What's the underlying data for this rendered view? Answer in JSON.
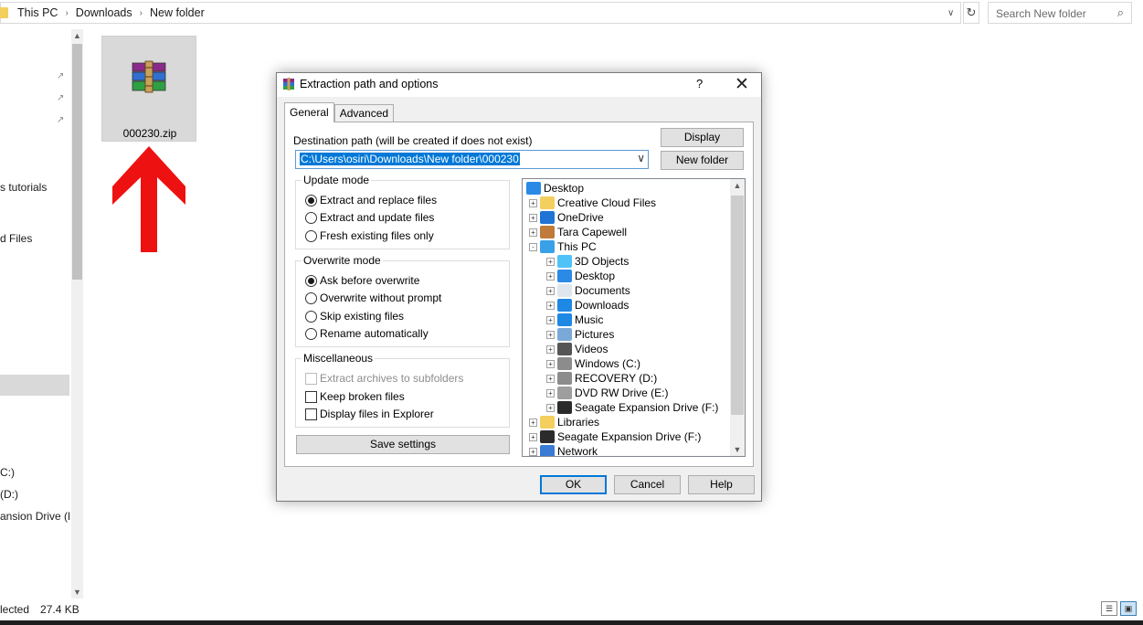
{
  "explorer": {
    "breadcrumb": [
      "This PC",
      "Downloads",
      "New folder"
    ],
    "search_placeholder": "Search New folder",
    "nav_items": [
      "s tutorials",
      "d Files",
      "C:)",
      "(D:)",
      "ansion Drive (F"
    ],
    "file_name": "000230.zip",
    "status_selected": "lected",
    "status_size": "27.4 KB"
  },
  "dialog": {
    "title": "Extraction path and options",
    "help_glyph": "?",
    "tabs": [
      "General",
      "Advanced"
    ],
    "dest_label": "Destination path (will be created if does not exist)",
    "dest_value": "C:\\Users\\osiri\\Downloads\\New folder\\000230",
    "display_button": "Display",
    "new_folder_button": "New folder",
    "update_mode": {
      "title": "Update mode",
      "options": [
        "Extract and replace files",
        "Extract and update files",
        "Fresh existing files only"
      ],
      "selected": 0
    },
    "overwrite_mode": {
      "title": "Overwrite mode",
      "options": [
        "Ask before overwrite",
        "Overwrite without prompt",
        "Skip existing files",
        "Rename automatically"
      ],
      "selected": 0
    },
    "misc": {
      "title": "Miscellaneous",
      "options": [
        "Extract archives to subfolders",
        "Keep broken files",
        "Display files in Explorer"
      ],
      "disabled": [
        true,
        false,
        false
      ],
      "checked": [
        false,
        false,
        false
      ]
    },
    "save_settings": "Save settings",
    "tree": [
      {
        "label": "Desktop",
        "icon": "desktop-icon",
        "expander": "",
        "level": 0
      },
      {
        "label": "Creative Cloud Files",
        "icon": "creative-cloud-folder-icon",
        "expander": "+",
        "level": 1
      },
      {
        "label": "OneDrive",
        "icon": "onedrive-cloud-icon",
        "expander": "+",
        "level": 1
      },
      {
        "label": "Tara Capewell",
        "icon": "user-icon",
        "expander": "+",
        "level": 1
      },
      {
        "label": "This PC",
        "icon": "computer-icon",
        "expander": "-",
        "level": 1
      },
      {
        "label": "3D Objects",
        "icon": "3d-objects-icon",
        "expander": "+",
        "level": 2
      },
      {
        "label": "Desktop",
        "icon": "desktop-icon",
        "expander": "+",
        "level": 2
      },
      {
        "label": "Documents",
        "icon": "documents-icon",
        "expander": "+",
        "level": 2
      },
      {
        "label": "Downloads",
        "icon": "downloads-icon",
        "expander": "+",
        "level": 2
      },
      {
        "label": "Music",
        "icon": "music-icon",
        "expander": "+",
        "level": 2
      },
      {
        "label": "Pictures",
        "icon": "pictures-icon",
        "expander": "+",
        "level": 2
      },
      {
        "label": "Videos",
        "icon": "videos-icon",
        "expander": "+",
        "level": 2
      },
      {
        "label": "Windows (C:)",
        "icon": "windows-drive-icon",
        "expander": "+",
        "level": 2
      },
      {
        "label": "RECOVERY (D:)",
        "icon": "drive-icon",
        "expander": "+",
        "level": 2
      },
      {
        "label": "DVD RW Drive (E:)",
        "icon": "dvd-drive-icon",
        "expander": "+",
        "level": 2
      },
      {
        "label": "Seagate Expansion Drive (F:)",
        "icon": "external-drive-icon",
        "expander": "+",
        "level": 2
      },
      {
        "label": "Libraries",
        "icon": "libraries-icon",
        "expander": "+",
        "level": 1
      },
      {
        "label": "Seagate Expansion Drive (F:)",
        "icon": "external-drive-icon",
        "expander": "+",
        "level": 1
      },
      {
        "label": "Network",
        "icon": "network-icon",
        "expander": "+",
        "level": 1
      }
    ],
    "ok": "OK",
    "cancel": "Cancel",
    "help": "Help"
  },
  "colors": {
    "selection": "#0078d7",
    "arrow": "#ee1111",
    "dialog_bg": "#f0f0f0"
  }
}
